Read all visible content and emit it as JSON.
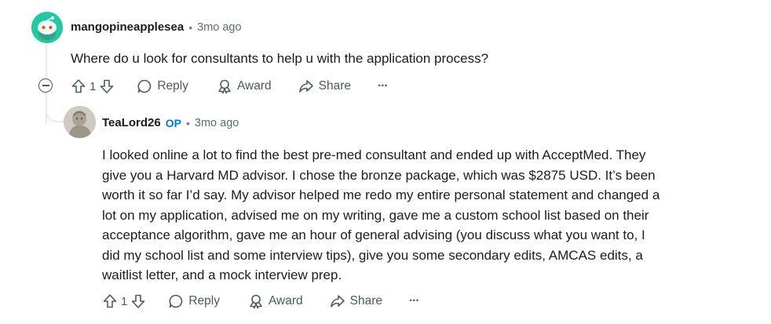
{
  "comment1": {
    "username": "mangopineapplesea",
    "separator": "•",
    "time": "3mo ago",
    "text": "Where do u look for consultants to help u with the application process?",
    "votes": "1",
    "reply_label": "Reply",
    "award_label": "Award",
    "share_label": "Share",
    "more_label": "···"
  },
  "comment2": {
    "username": "TeaLord26",
    "op_badge": "OP",
    "separator": "•",
    "time": "3mo ago",
    "lines": [
      "I looked online a lot to find the best pre-med consultant and ended up with AcceptMed. They",
      "give you a Harvard MD advisor. I chose the bronze package, which was $2875 USD. It’s been",
      "worth it so far I’d say. My advisor helped me redo my entire personal statement and changed a",
      "lot on my application, advised me on my writing, gave me a custom school list based on their",
      "acceptance algorithm, gave me an hour of general advising (you discuss what you want to, I",
      "did my school list and some interview tips), give you some secondary edits, AMCAS edits, a",
      "waitlist letter, and a mock interview prep."
    ],
    "votes": "1",
    "reply_label": "Reply",
    "award_label": "Award",
    "share_label": "Share",
    "more_label": "···"
  },
  "colors": {
    "avatar1": "#24c8a0",
    "op": "#0079d3",
    "meta": "#576f76"
  }
}
